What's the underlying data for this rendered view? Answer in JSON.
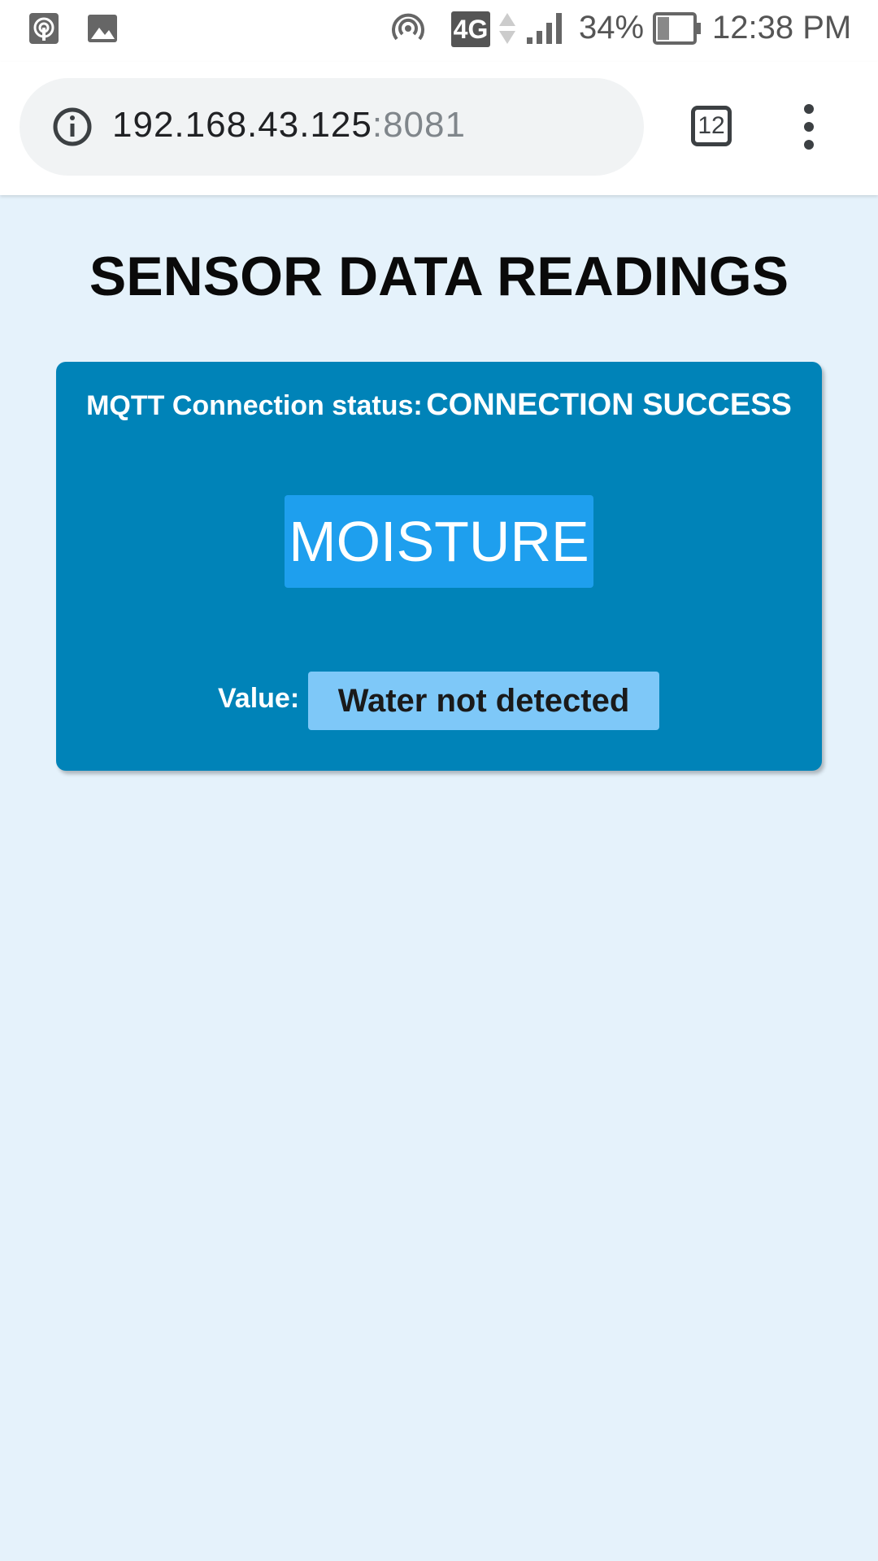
{
  "status_bar": {
    "icons_left": [
      "hotspot-icon",
      "image-notification-icon"
    ],
    "icons_right": [
      "hotspot-icon",
      "network-4g-icon",
      "data-arrows-icon",
      "signal-icon",
      "battery-icon"
    ],
    "network_label": "4G",
    "battery_percent": "34%",
    "time": "12:38 PM"
  },
  "browser": {
    "url_host": "192.168.43.125",
    "url_port": ":8081",
    "tab_count": "12"
  },
  "page": {
    "title": "SENSOR DATA READINGS",
    "connection_label": "MQTT Connection status:",
    "connection_status": "CONNECTION SUCCESS",
    "sensor_name": "MOISTURE",
    "value_label": "Value:",
    "value": "Water not detected"
  },
  "colors": {
    "page_background": "#e5f2fb",
    "card_background": "#0083b8",
    "sensor_badge": "#1e9fee",
    "value_badge": "#7ec8f8"
  }
}
